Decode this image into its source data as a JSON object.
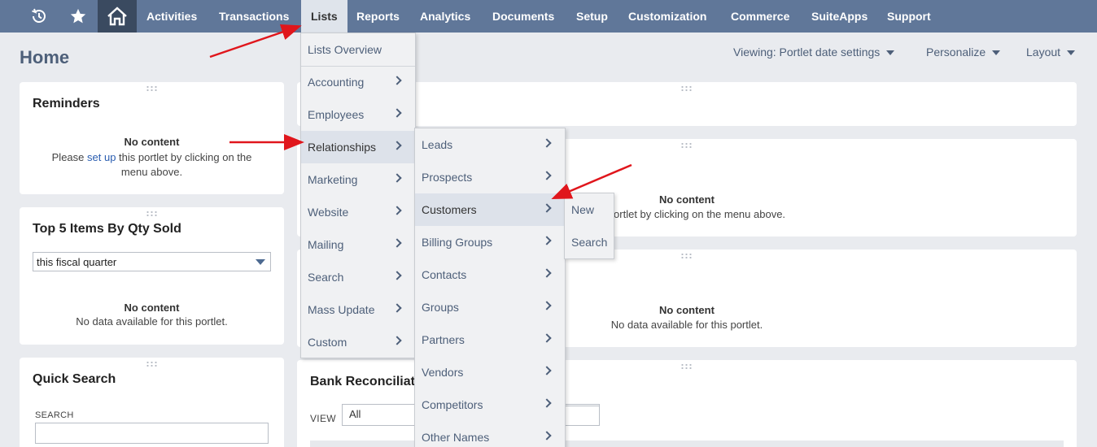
{
  "nav": {
    "icons": [
      "recent-activity-icon",
      "star-icon",
      "home-icon"
    ],
    "items": [
      "Activities",
      "Transactions",
      "Lists",
      "Reports",
      "Analytics",
      "Documents",
      "Setup",
      "Customization",
      "Commerce",
      "SuiteApps",
      "Support"
    ],
    "active": "Lists"
  },
  "page": {
    "title": "Home",
    "viewing": "Viewing: Portlet date settings",
    "personalize": "Personalize",
    "layout": "Layout"
  },
  "reminders": {
    "title": "Reminders",
    "no_content": "No content",
    "msg_before": "Please ",
    "msg_link": "set up",
    "msg_after": " this portlet by clicking on the",
    "msg_line2": "menu above."
  },
  "top_items": {
    "title": "Top 5 Items By Qty Sold",
    "period": "this fiscal quarter",
    "no_content": "No content",
    "msg": "No data available for this portlet."
  },
  "quick_search": {
    "title": "Quick Search",
    "search_label": "SEARCH"
  },
  "center": {
    "p2_no_content": "No content",
    "p2_msg": "this portlet by clicking on the menu above.",
    "p3_no_content": "No content",
    "p3_msg": "No data available for this portlet.",
    "bank_title": "Bank Reconciliati",
    "view_label": "VIEW",
    "view_value": "All"
  },
  "lists_menu": [
    "Lists Overview",
    "Accounting",
    "Employees",
    "Relationships",
    "Marketing",
    "Website",
    "Mailing",
    "Search",
    "Mass Update",
    "Custom"
  ],
  "relationships_menu": [
    "Leads",
    "Prospects",
    "Customers",
    "Billing Groups",
    "Contacts",
    "Groups",
    "Partners",
    "Vendors",
    "Competitors",
    "Other Names"
  ],
  "customers_menu": [
    "New",
    "Search"
  ],
  "colors": {
    "nav_bg": "#607799",
    "nav_active_bg": "#dfe4eb",
    "home_bg": "#3a4a60",
    "annotation_arrow": "#e0161c"
  }
}
